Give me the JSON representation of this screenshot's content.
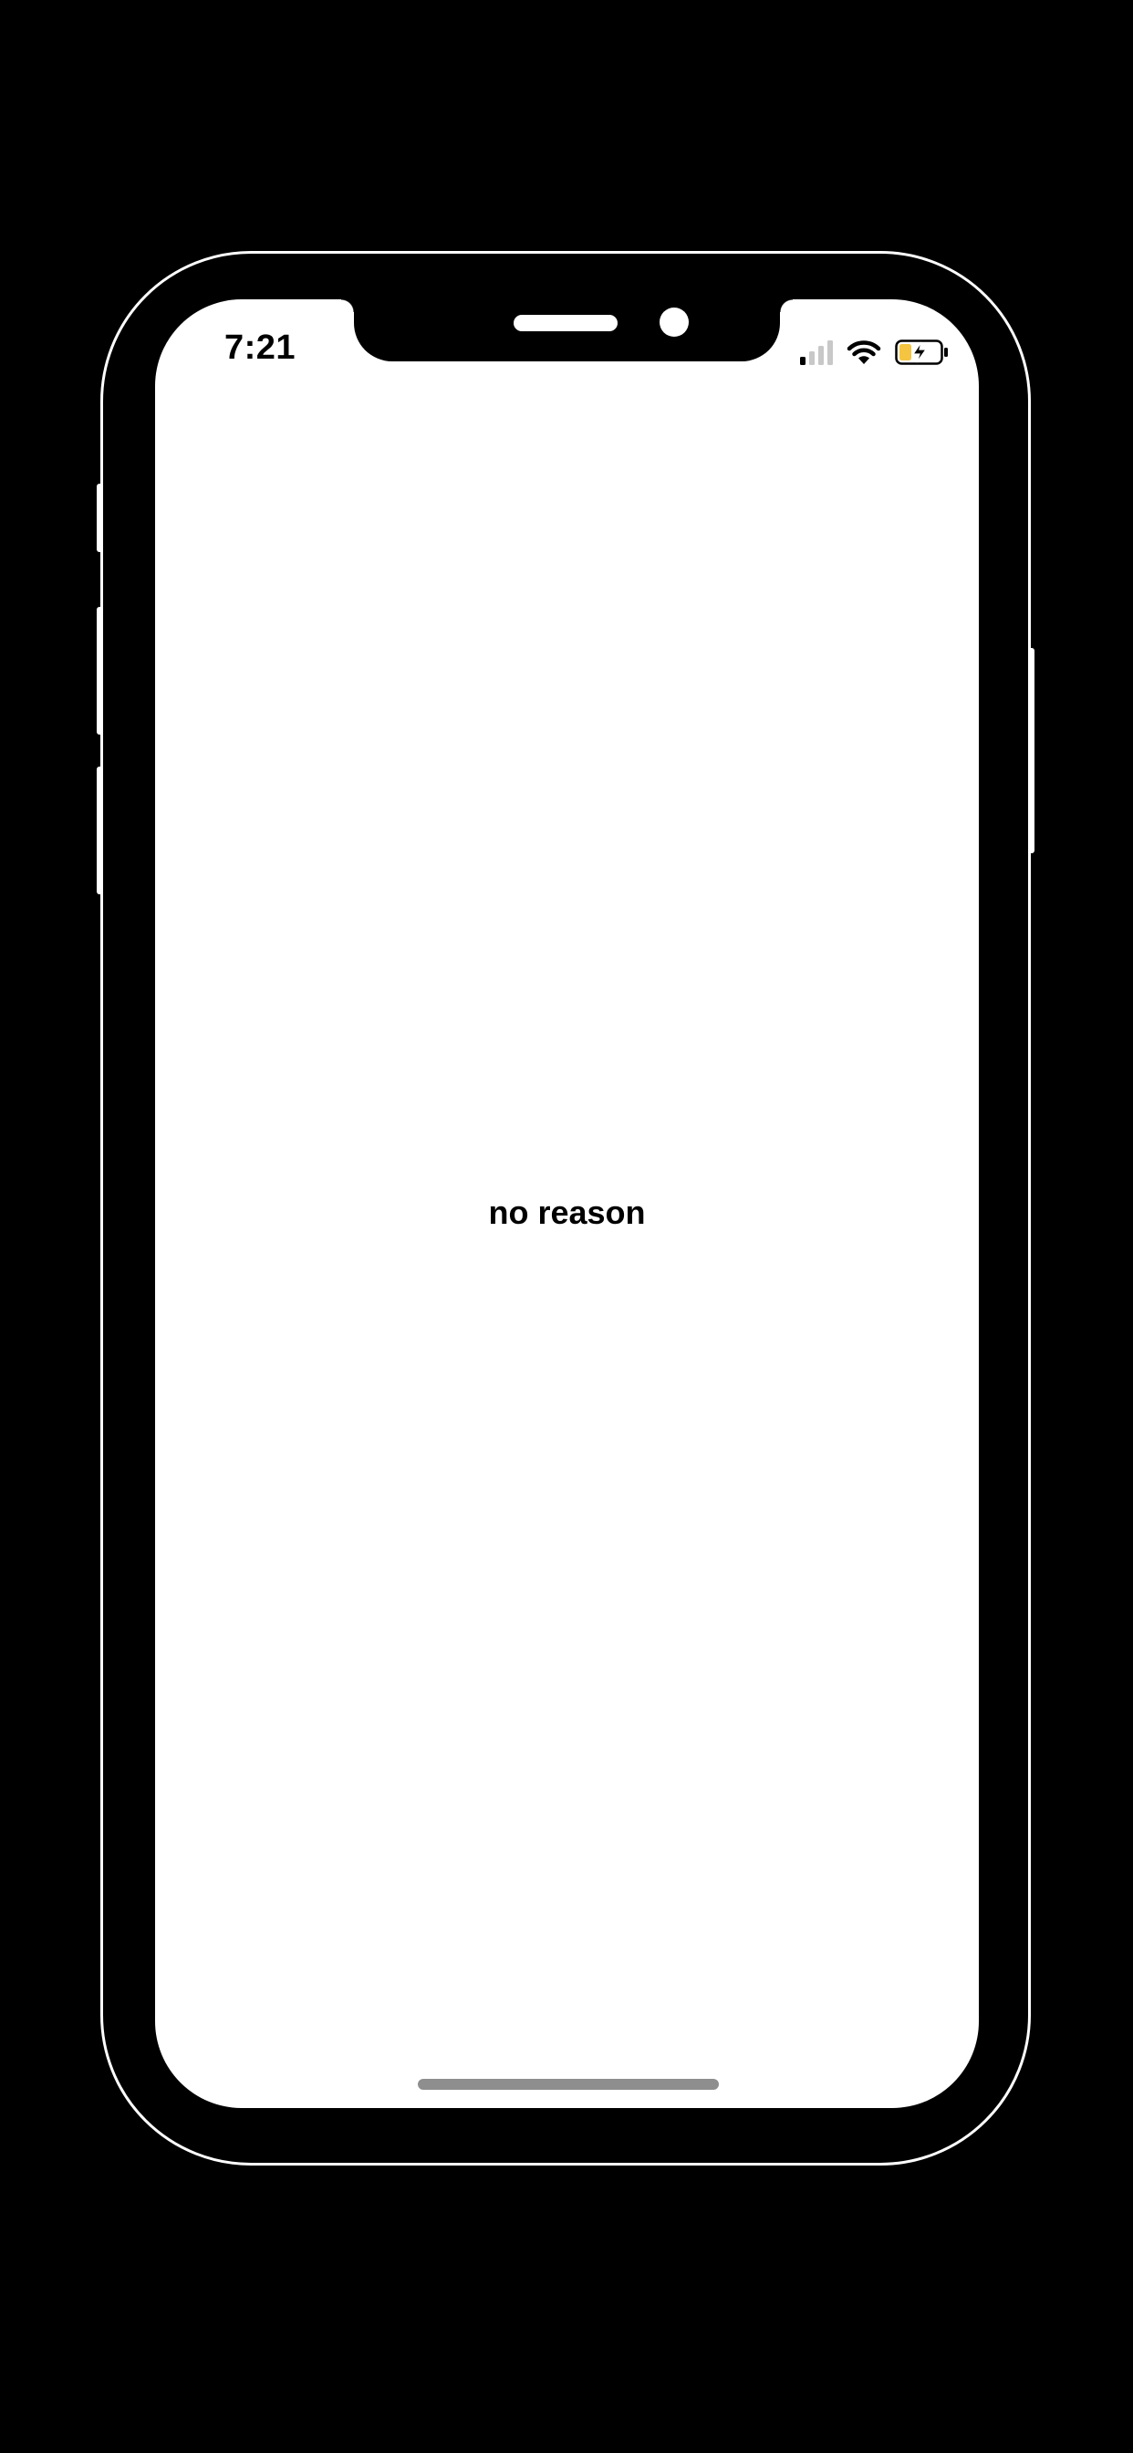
{
  "status_bar": {
    "time": "7:21",
    "cellular_signal": {
      "icon": "cellular-signal-icon",
      "active_bars": 1,
      "total_bars": 4
    },
    "wifi": {
      "icon": "wifi-icon"
    },
    "battery": {
      "icon": "battery-charging-icon",
      "charging": true,
      "level": 0.3,
      "fill_color": "#f5c542"
    }
  },
  "main": {
    "message": "no reason"
  },
  "device": {
    "frame_color": "#000000",
    "outline_color": "#ffffff",
    "screen_background": "#ffffff",
    "home_indicator_color": "#8e8e8e"
  }
}
